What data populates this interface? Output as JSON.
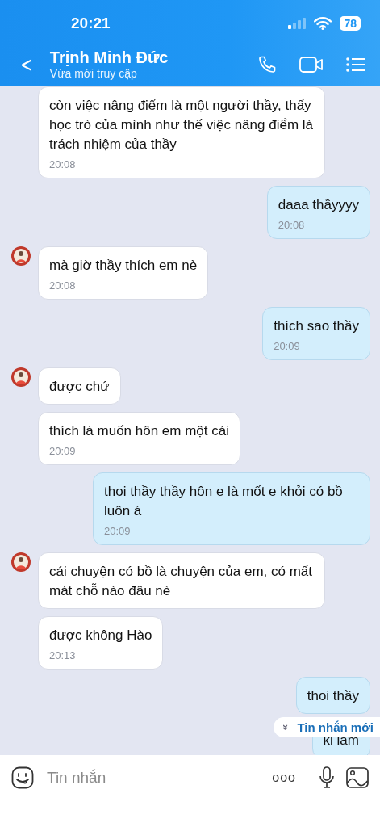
{
  "status_bar": {
    "time": "20:21",
    "battery": "78"
  },
  "header": {
    "back": "<",
    "title": "Trịnh Minh Đức",
    "subtitle": "Vừa mới truy cập"
  },
  "messages": [
    {
      "kind": "in",
      "avatar": false,
      "text": "còn việc nâng điểm là một người thầy, thấy học trò của mình như thế việc nâng điểm là trách nhiệm của thầy",
      "time": "20:08"
    },
    {
      "kind": "out",
      "text": "daaa thầyyyy",
      "time": "20:08"
    },
    {
      "kind": "in",
      "avatar": true,
      "text": "mà giờ thầy thích em nè",
      "time": "20:08"
    },
    {
      "kind": "out",
      "text": "thích sao thầy",
      "time": "20:09"
    },
    {
      "kind": "in",
      "avatar": true,
      "text": "được chứ"
    },
    {
      "kind": "in",
      "avatar": false,
      "text": "thích là muốn hôn em một cái",
      "time": "20:09"
    },
    {
      "kind": "out",
      "text": "thoi thầy thầy hôn e là mốt e khỏi có bồ luôn á",
      "time": "20:09"
    },
    {
      "kind": "in",
      "avatar": true,
      "text": "cái chuyện có bồ là chuyện của em, có mất mát chỗ nào đâu nè"
    },
    {
      "kind": "in",
      "avatar": false,
      "text": "được không Hào",
      "time": "20:13"
    },
    {
      "kind": "out",
      "text": "thoi thầy"
    },
    {
      "kind": "out",
      "text": "ki lam"
    }
  ],
  "new_messages_pill": {
    "icon": "»",
    "label": "Tin nhắn mới"
  },
  "composer": {
    "placeholder": "Tin nhắn",
    "more": "ooo"
  }
}
